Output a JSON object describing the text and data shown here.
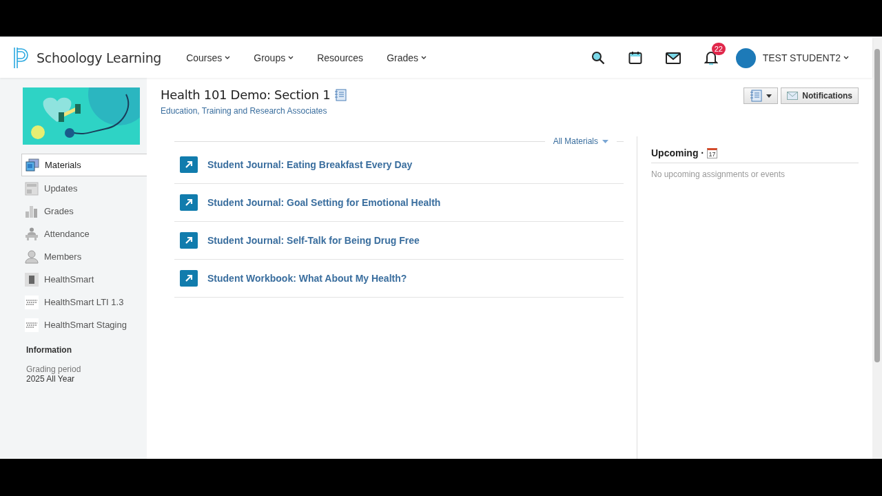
{
  "header": {
    "brand": "Schoology Learning",
    "nav": [
      {
        "label": "Courses",
        "dropdown": true
      },
      {
        "label": "Groups",
        "dropdown": true
      },
      {
        "label": "Resources",
        "dropdown": false
      },
      {
        "label": "Grades",
        "dropdown": true
      }
    ],
    "notification_count": "22",
    "user": "TEST STUDENT2"
  },
  "sidebar": {
    "items": [
      {
        "label": "Materials",
        "kind": "materials",
        "selected": true
      },
      {
        "label": "Updates",
        "kind": "updates",
        "selected": false
      },
      {
        "label": "Grades",
        "kind": "grades",
        "selected": false
      },
      {
        "label": "Attendance",
        "kind": "attendance",
        "selected": false
      },
      {
        "label": "Members",
        "kind": "members",
        "selected": false
      },
      {
        "label": "HealthSmart",
        "kind": "app",
        "selected": false
      },
      {
        "label": "HealthSmart LTI 1.3",
        "kind": "logo",
        "selected": false
      },
      {
        "label": "HealthSmart Staging",
        "kind": "logo",
        "selected": false
      }
    ],
    "information": {
      "heading": "Information",
      "label": "Grading period",
      "value": "2025 All Year"
    }
  },
  "course": {
    "title": "Health 101 Demo: Section 1",
    "subtitle": "Education, Training and Research Associates",
    "notifications_button": "Notifications"
  },
  "materials": {
    "filter": "All Materials",
    "items": [
      "Student Journal: Eating Breakfast Every Day",
      "Student Journal: Goal Setting for Emotional Health",
      "Student Journal: Self-Talk for Being Drug Free",
      "Student Workbook: What About My Health?"
    ]
  },
  "upcoming": {
    "heading": "Upcoming ·",
    "calendar_day": "17",
    "empty_text": "No upcoming assignments or events"
  }
}
